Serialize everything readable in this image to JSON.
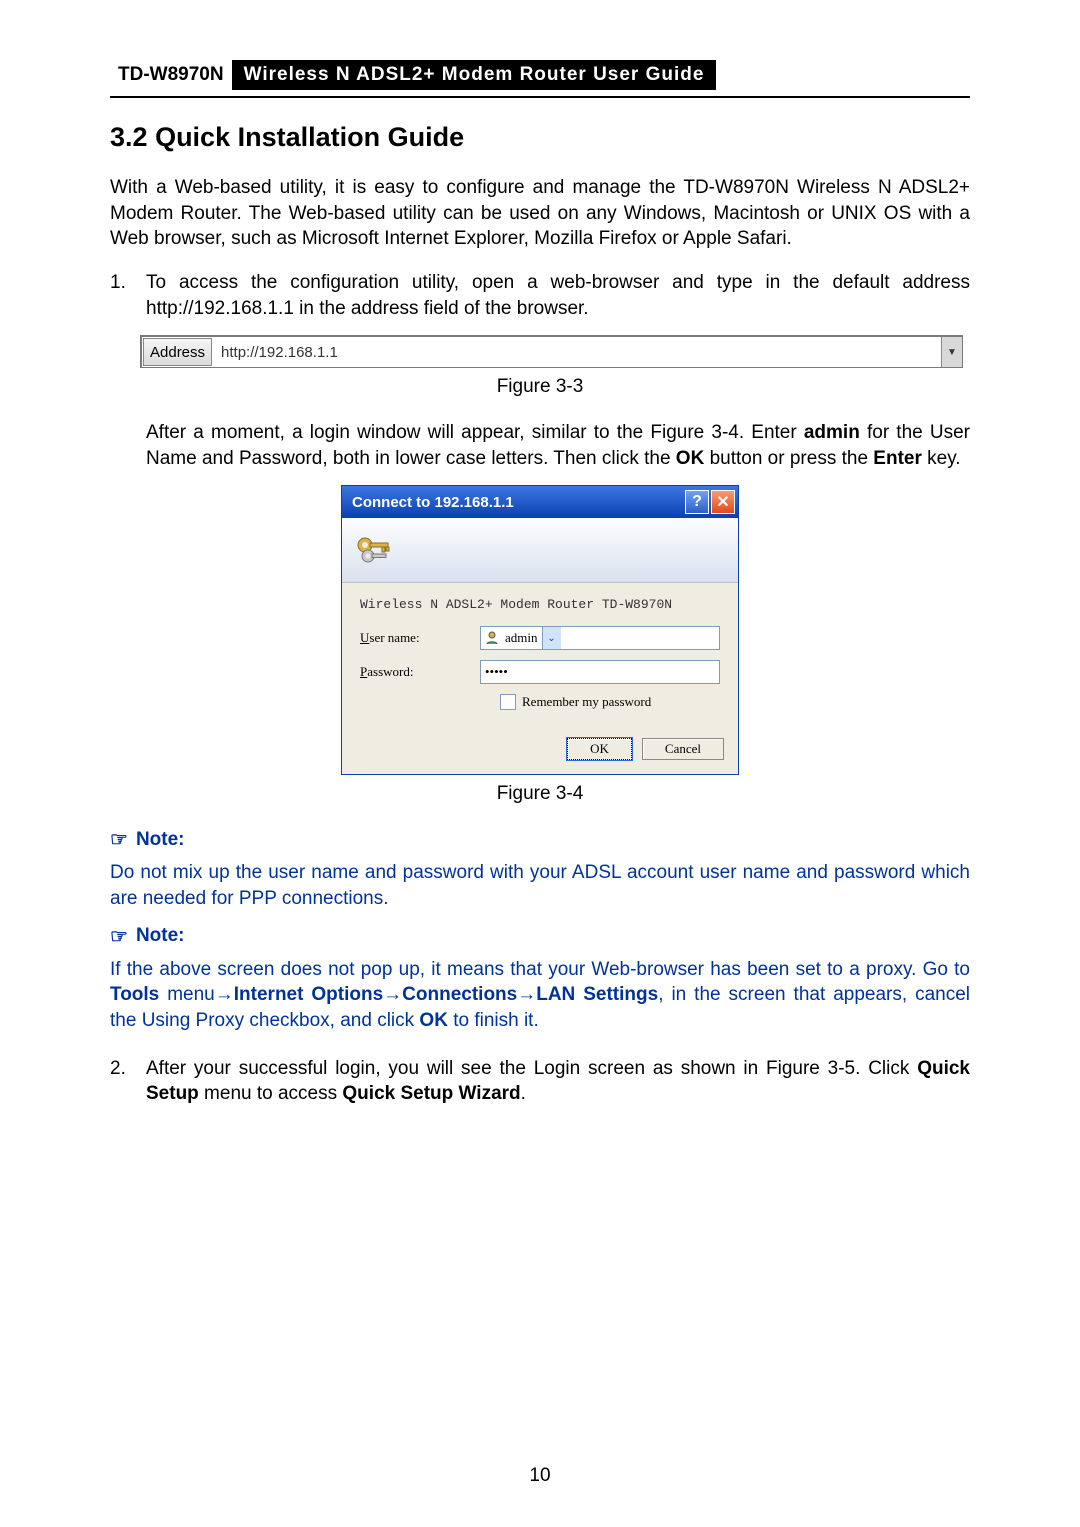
{
  "header": {
    "model": "TD-W8970N",
    "guide": "Wireless N ADSL2+ Modem Router User Guide"
  },
  "section": {
    "number": "3.2",
    "title": "Quick Installation Guide"
  },
  "intro": "With a Web-based utility, it is easy to configure and manage the TD-W8970N Wireless N ADSL2+ Modem Router. The Web-based utility can be used on any Windows, Macintosh or UNIX OS with a Web browser, such as Microsoft Internet Explorer, Mozilla Firefox or Apple Safari.",
  "step1": {
    "num": "1.",
    "text": "To access the configuration utility, open a web-browser and type in the default address http://192.168.1.1 in the address field of the browser."
  },
  "addrbar": {
    "button": "Address",
    "url": "http://192.168.1.1"
  },
  "fig33": "Figure 3-3",
  "after_login": {
    "pre": "After a moment, a login window will appear, similar to the Figure 3-4. Enter ",
    "admin": "admin",
    "mid": " for the User Name and Password, both in lower case letters. Then click the ",
    "ok": "OK",
    "mid2": " button or press the ",
    "enter": "Enter",
    "post": " key."
  },
  "login": {
    "title": "Connect to 192.168.1.1",
    "realm": "Wireless N ADSL2+ Modem Router TD-W8970N",
    "user_label_pre": "U",
    "user_label_post": "ser name:",
    "user_value": "admin",
    "pass_label_pre": "P",
    "pass_label_post": "assword:",
    "pass_value": "•••••",
    "remember_pre": "R",
    "remember_post": "emember my password",
    "ok": "OK",
    "cancel": "Cancel"
  },
  "fig34": "Figure 3-4",
  "note_label": "Note:",
  "note1": "Do not mix up the user name and password with your ADSL account user name and password which are needed for PPP connections.",
  "note2": {
    "pre": "If the above screen does not pop up, it means that your Web-browser has been set to a proxy. Go to ",
    "tools": "Tools",
    "s1": " menu→",
    "io": "Internet Options",
    "s2": "→",
    "conn": "Connections",
    "s3": "→",
    "lan": "LAN Settings",
    "mid": ", in the screen that appears, cancel the Using Proxy checkbox, and click ",
    "ok": "OK",
    "post": " to finish it."
  },
  "step2": {
    "num": "2.",
    "pre": "After your successful login, you will see the Login screen as shown in Figure 3-5. Click ",
    "qs": "Quick Setup",
    "mid": " menu to access ",
    "qsw": "Quick Setup Wizard",
    "post": "."
  },
  "page_number": "10"
}
